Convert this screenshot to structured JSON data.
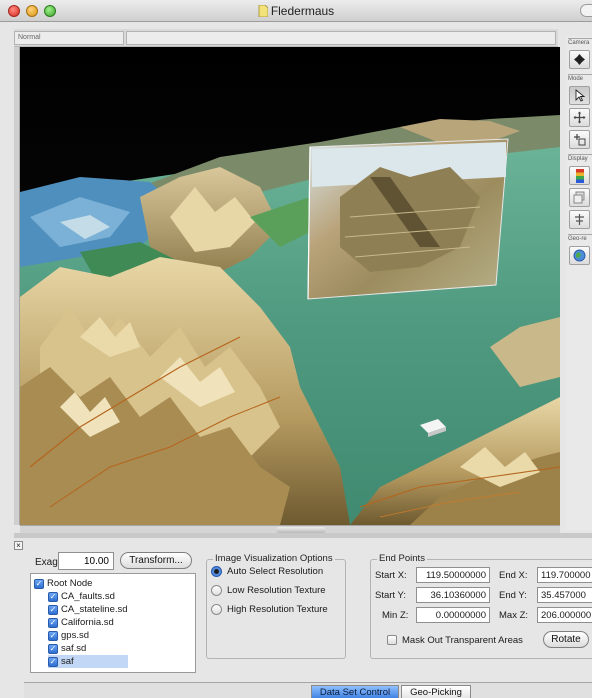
{
  "window": {
    "title": "Fledermaus"
  },
  "strip": {
    "tab_label": "Normal"
  },
  "right_toolbar": {
    "groups": [
      "Camera",
      "Mode",
      "Display",
      "Geo-re"
    ],
    "tools": [
      "camera-orbit-icon",
      "pointer-icon",
      "move-icon",
      "add-point-icon",
      "colormap-icon",
      "layers-icon",
      "align-icon",
      "globe-icon"
    ]
  },
  "controls": {
    "exag_label": "Exag:",
    "exag_value": "10.00",
    "transform_button": "Transform..."
  },
  "tree": {
    "items": [
      {
        "label": "Root Node",
        "checked": true,
        "selected": false
      },
      {
        "label": "CA_faults.sd",
        "checked": true,
        "selected": false
      },
      {
        "label": "CA_stateline.sd",
        "checked": true,
        "selected": false
      },
      {
        "label": "California.sd",
        "checked": true,
        "selected": false
      },
      {
        "label": "gps.sd",
        "checked": true,
        "selected": false
      },
      {
        "label": "saf.sd",
        "checked": true,
        "selected": false
      },
      {
        "label": "saf",
        "checked": true,
        "selected": true
      }
    ]
  },
  "image_options": {
    "title": "Image Visualization Options",
    "options": [
      {
        "label": "Auto Select Resolution",
        "selected": true
      },
      {
        "label": "Low Resolution Texture",
        "selected": false
      },
      {
        "label": "High Resolution Texture",
        "selected": false
      }
    ]
  },
  "end_points": {
    "title": "End Points",
    "start_x_label": "Start X:",
    "start_x": "119.50000000",
    "end_x_label": "End X:",
    "end_x": "119.700000",
    "start_y_label": "Start Y:",
    "start_y": "36.10360000",
    "end_y_label": "End Y:",
    "end_y": "35.457000",
    "min_z_label": "Min Z:",
    "min_z": "0.00000000",
    "max_z_label": "Max Z:",
    "max_z": "206.000000",
    "mask_label": "Mask Out Transparent Areas",
    "mask_checked": false,
    "rotate_button": "Rotate"
  },
  "tabs": {
    "items": [
      "Data Set Control",
      "Geo-Picking"
    ],
    "active": 0
  },
  "colors": {
    "sea": "#5aa58a",
    "terrain": "#c9b27a",
    "sky": "#000000",
    "accent": "#3b7fe0"
  }
}
